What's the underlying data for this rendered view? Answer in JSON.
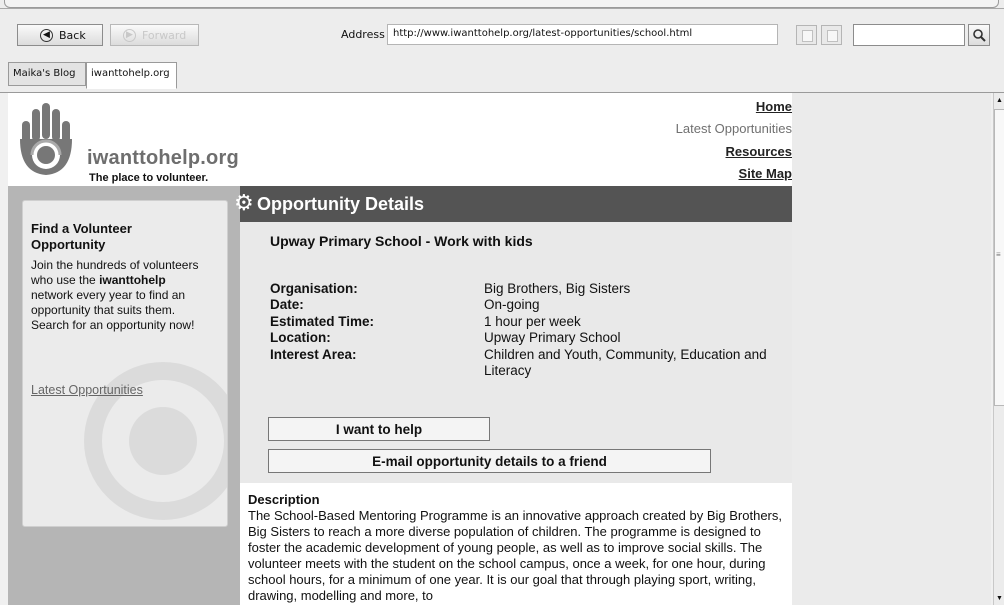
{
  "browser": {
    "back_label": "Back",
    "forward_label": "Forward",
    "address_label": "Address",
    "address_value": "http://www.iwanttohelp.org/latest-opportunities/school.html",
    "search_value": "",
    "tabs": [
      {
        "label": "Maika's Blog"
      },
      {
        "label": "iwanttohelp.org"
      }
    ]
  },
  "site": {
    "logo_text": "iwanttohelp.org",
    "tagline": "The place to volunteer.",
    "nav": {
      "home": "Home",
      "latest": "Latest Opportunities",
      "resources": "Resources",
      "sitemap": "Site Map"
    }
  },
  "sidebar": {
    "title": "Find a Volunteer Opportunity",
    "body_1": "Join the hundreds of volunteers who use the",
    "body_brand": "iwanttohelp",
    "body_2": "network every year to find an opportunity that suits them. Search for an opportunity now!",
    "link": "Latest Opportunities"
  },
  "details": {
    "header": "Opportunity Details",
    "title": "Upway Primary School - Work with kids",
    "fields": [
      {
        "label": "Organisation:",
        "value": "Big Brothers, Big Sisters"
      },
      {
        "label": "Date:",
        "value": "On-going"
      },
      {
        "label": "Estimated Time:",
        "value": "1 hour per week"
      },
      {
        "label": "Location:",
        "value": "Upway Primary School"
      },
      {
        "label": "Interest Area:",
        "value": "Children and Youth, Community, Education and Literacy"
      }
    ],
    "help_button": "I want to help",
    "email_button": "E-mail opportunity details to a friend"
  },
  "description": {
    "heading": "Description",
    "body": "The School-Based Mentoring Programme is an innovative approach created by Big Brothers, Big Sisters to reach a more diverse population of children. The programme is designed to foster the academic development of young people, as well as to improve social skills. The volunteer meets with the student on the school campus, once a week, for one hour, during school hours, for a minimum of one year. It is our goal that through playing sport, writing, drawing, modelling and more, to"
  }
}
